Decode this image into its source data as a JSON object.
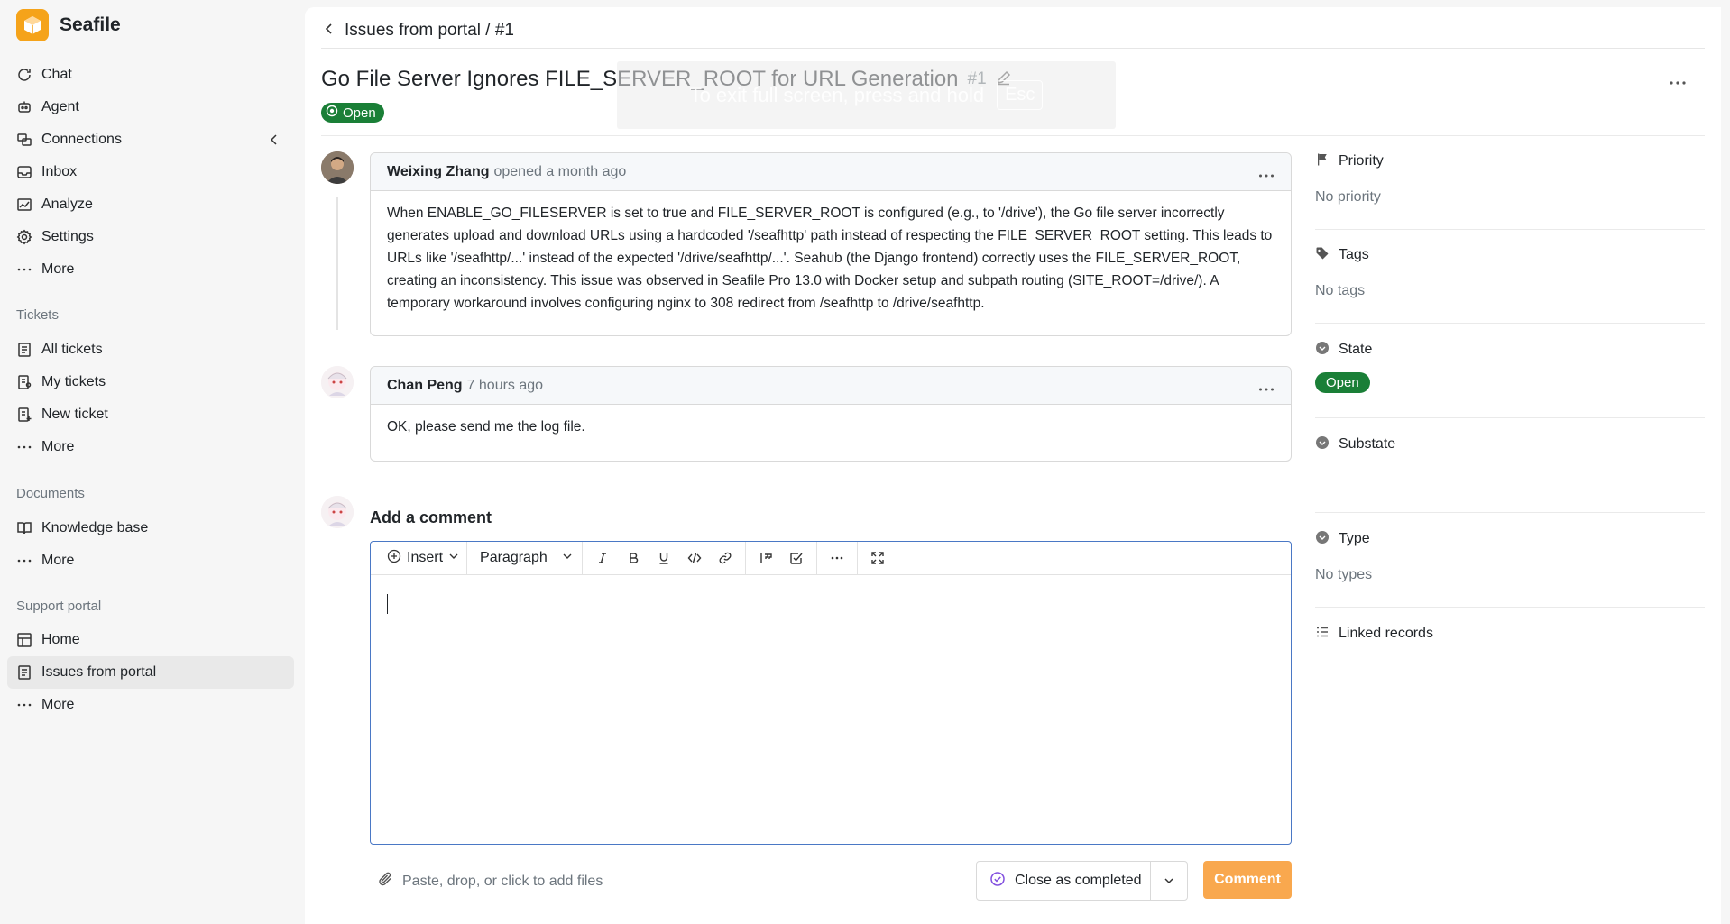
{
  "app": {
    "name": "Seafile",
    "accent": "#f5a31a"
  },
  "sidebar": {
    "main_items": [
      {
        "label": "Chat",
        "icon": "chat-icon"
      },
      {
        "label": "Agent",
        "icon": "agent-icon"
      },
      {
        "label": "Connections",
        "icon": "connections-icon"
      },
      {
        "label": "Inbox",
        "icon": "inbox-icon"
      },
      {
        "label": "Analyze",
        "icon": "analyze-icon"
      },
      {
        "label": "Settings",
        "icon": "gear-icon"
      },
      {
        "label": "More",
        "icon": "more-icon"
      }
    ],
    "tickets": {
      "title": "Tickets",
      "items": [
        {
          "label": "All tickets"
        },
        {
          "label": "My tickets"
        },
        {
          "label": "New ticket"
        },
        {
          "label": "More"
        }
      ]
    },
    "documents": {
      "title": "Documents",
      "items": [
        {
          "label": "Knowledge base"
        },
        {
          "label": "More"
        }
      ]
    },
    "support": {
      "title": "Support portal",
      "items": [
        {
          "label": "Home"
        },
        {
          "label": "Issues from portal",
          "active": true
        },
        {
          "label": "More"
        }
      ]
    }
  },
  "header": {
    "breadcrumb": "Issues from portal / #1",
    "title": "Go File Server Ignores FILE_SERVER_ROOT for URL Generation",
    "number": "#1",
    "status": "Open",
    "status_color": "#1a7f37"
  },
  "fullscreen_hint": {
    "text": "To exit full screen, press and hold",
    "key": "Esc"
  },
  "comments": [
    {
      "author": "Weixing Zhang",
      "time": "opened a month ago",
      "body": "When ENABLE_GO_FILESERVER is set to true and FILE_SERVER_ROOT is configured (e.g., to '/drive'), the Go file server incorrectly generates upload and download URLs using a hardcoded '/seafhttp' path instead of respecting the FILE_SERVER_ROOT setting. This leads to URLs like '/seafhttp/...' instead of the expected '/drive/seafhttp/...'. Seahub (the Django frontend) correctly uses the FILE_SERVER_ROOT, creating an inconsistency. This issue was observed in Seafile Pro 13.0 with Docker setup and subpath routing (SITE_ROOT=/drive/). A temporary workaround involves configuring nginx to 308 redirect from /seafhttp to /drive/seafhttp."
    },
    {
      "author": "Chan Peng",
      "time": "7 hours ago",
      "body": "OK, please send me the log file."
    }
  ],
  "composer": {
    "title": "Add a comment",
    "insert_label": "Insert",
    "block_label": "Paragraph",
    "attach_text": "Paste, drop, or click to add files",
    "close_label": "Close as completed",
    "submit_label": "Comment",
    "submit_color": "#f9a84e"
  },
  "details": {
    "priority": {
      "label": "Priority",
      "value": "No priority"
    },
    "tags": {
      "label": "Tags",
      "value": "No tags"
    },
    "state": {
      "label": "State",
      "value": "Open"
    },
    "substate": {
      "label": "Substate"
    },
    "type": {
      "label": "Type",
      "value": "No types"
    },
    "linked": {
      "label": "Linked records"
    }
  }
}
